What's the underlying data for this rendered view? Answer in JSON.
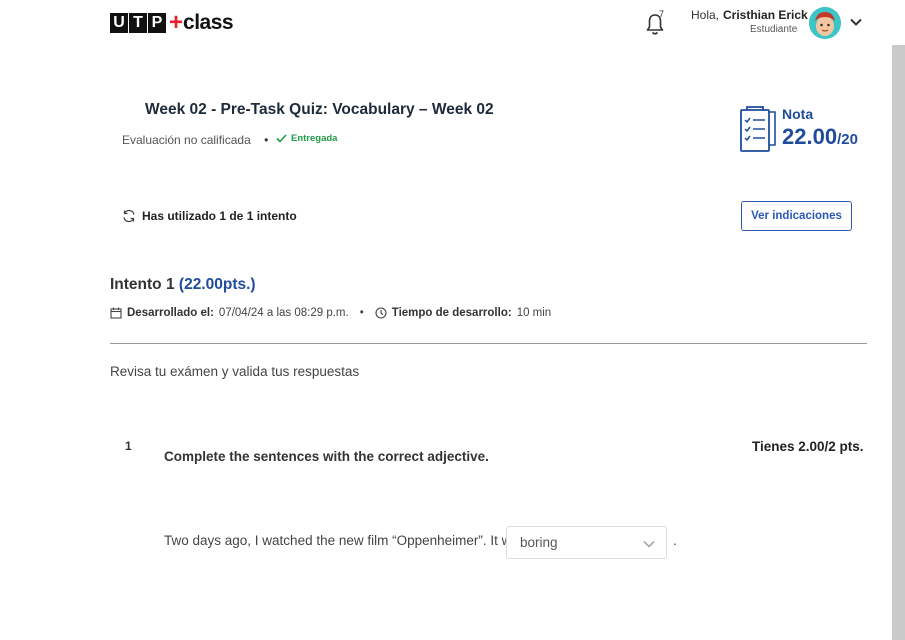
{
  "header": {
    "logo_box_letters": [
      "U",
      "T",
      "P"
    ],
    "logo_plus": "+",
    "logo_class": "class",
    "notifications_count": "7",
    "greeting": "Hola,",
    "user_name": "Cristhian Erick",
    "user_role": "Estudiante"
  },
  "quiz": {
    "title": "Week 02 - Pre-Task Quiz: Vocabulary – Week 02",
    "eval_note": "Evaluación no calificada",
    "status": "Entregada",
    "nota_label": "Nota",
    "nota_value": "22.00",
    "nota_max": "/20",
    "attempts_text": "Has utilizado 1 de 1 intento",
    "instructions_button": "Ver indicaciones"
  },
  "attempt": {
    "label": "Intento 1",
    "points": "(22.00pts.)",
    "developed_label": "Desarrollado el:",
    "developed_value": "07/04/24 a las 08:29 p.m.",
    "time_label": "Tiempo de desarrollo:",
    "time_value": "10 min"
  },
  "review_text": "Revisa tu exámen y valida tus respuestas",
  "question": {
    "number": "1",
    "prompt": "Complete the sentences with the correct adjective.",
    "score": "Tienes 2.00/2 pts.",
    "sentence": "Two days ago, I watched the new film “Oppenheimer”. It was",
    "selected_answer": "boring",
    "trailing": "."
  },
  "colors": {
    "brand_blue": "#1f4c9c",
    "button_blue": "#2c58b4",
    "success_green": "#1e9a48",
    "logo_red": "#e4202e"
  },
  "icons": [
    "bell-icon",
    "chevron-down-icon",
    "checkmark-icon",
    "clipboard-checklist-icon",
    "refresh-icon",
    "calendar-icon",
    "clock-icon",
    "avatar-icon"
  ]
}
